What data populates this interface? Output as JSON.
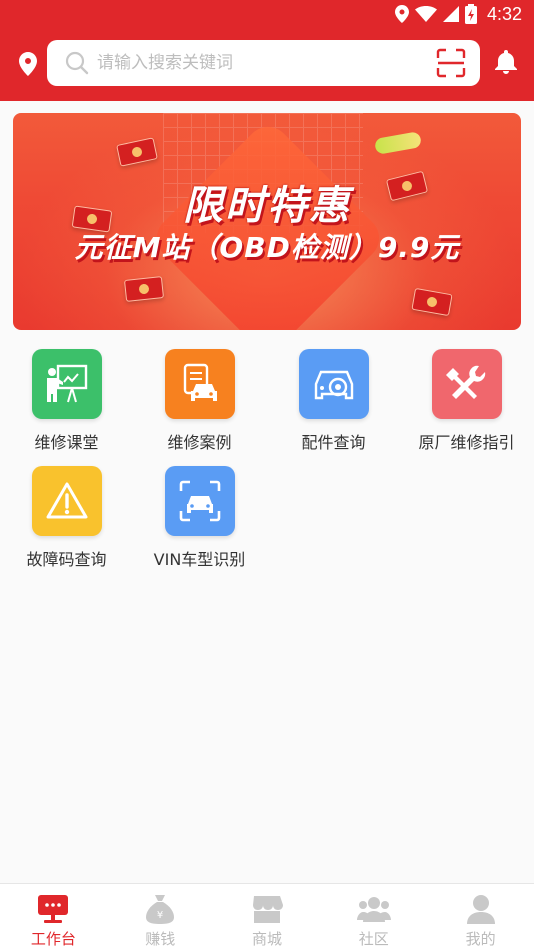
{
  "status_bar": {
    "time": "4:32"
  },
  "search": {
    "placeholder": "请输入搜索关键词"
  },
  "banner": {
    "title": "限时特惠",
    "subtitle": "元征M站（OBD检测）9.9元"
  },
  "menu": [
    {
      "label": "维修课堂",
      "icon": "classroom-icon",
      "color": "#3cc06a"
    },
    {
      "label": "维修案例",
      "icon": "car-case-icon",
      "color": "#f7811f"
    },
    {
      "label": "配件查询",
      "icon": "car-parts-icon",
      "color": "#5a9cf4"
    },
    {
      "label": "原厂维修指引",
      "icon": "tools-icon",
      "color": "#f0676d"
    },
    {
      "label": "故障码查询",
      "icon": "warning-icon",
      "color": "#f9c22d"
    },
    {
      "label": "VIN车型识别",
      "icon": "car-scan-icon",
      "color": "#5a9cf4"
    }
  ],
  "tabbar": [
    {
      "label": "工作台",
      "icon": "workbench-icon",
      "active": true
    },
    {
      "label": "赚钱",
      "icon": "money-bag-icon",
      "active": false
    },
    {
      "label": "商城",
      "icon": "store-icon",
      "active": false
    },
    {
      "label": "社区",
      "icon": "community-icon",
      "active": false
    },
    {
      "label": "我的",
      "icon": "profile-icon",
      "active": false
    }
  ],
  "colors": {
    "brand_red": "#e0272b",
    "inactive_gray": "#bbbbbb"
  }
}
